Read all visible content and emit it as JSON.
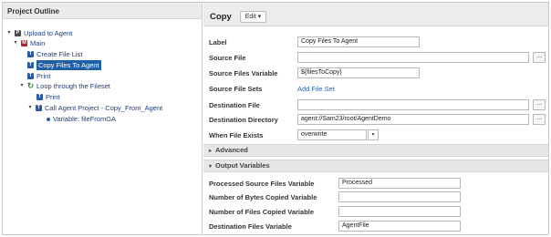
{
  "outline": {
    "title": "Project Outline",
    "nodes": [
      {
        "toggle": "▾",
        "icon": "P",
        "label": "Upload to Agent"
      },
      {
        "toggle": "▾",
        "icon": "M",
        "label": "Main"
      },
      {
        "toggle": "",
        "icon": "T",
        "label": "Create File List"
      },
      {
        "toggle": "",
        "icon": "T",
        "label": "Copy Files To Agent"
      },
      {
        "toggle": "",
        "icon": "T",
        "label": "Print"
      },
      {
        "toggle": "▾",
        "icon": "↻",
        "label": "Loop through the Fileset"
      },
      {
        "toggle": "",
        "icon": "T",
        "label": "Print"
      },
      {
        "toggle": "▾",
        "icon": "T",
        "label": "Call Agent Project - Copy_From_Agent"
      },
      {
        "toggle": "",
        "icon": "",
        "label": "Variable: fileFromGA"
      }
    ]
  },
  "detail": {
    "title": "Copy",
    "edit_label": "Edit ▾",
    "dots": "...",
    "fields": {
      "label": {
        "label": "Label",
        "value": "Copy Files To Agent"
      },
      "source_file": {
        "label": "Source File",
        "value": ""
      },
      "source_files_variable": {
        "label": "Source Files Variable",
        "value": "${filesToCopy}"
      },
      "source_file_sets": {
        "label": "Source File Sets",
        "link": "Add File Set"
      },
      "destination_file": {
        "label": "Destination File",
        "value": ""
      },
      "destination_directory": {
        "label": "Destination Directory",
        "value": "agent://Sam23/root/AgentDemo"
      },
      "when_file_exists": {
        "label": "When File Exists",
        "value": "overwrite",
        "arrow": "▾"
      }
    },
    "sections": {
      "advanced": {
        "arrow": "▸",
        "label": "Advanced"
      },
      "output_variables": {
        "arrow": "▾",
        "label": "Output Variables"
      }
    },
    "output": {
      "processed_source_files": {
        "label": "Processed Source Files Variable",
        "value": "Processed"
      },
      "bytes_copied": {
        "label": "Number of Bytes Copied Variable",
        "value": ""
      },
      "files_copied": {
        "label": "Number of Files Copied Variable",
        "value": ""
      },
      "destination_files": {
        "label": "Destination Files Variable",
        "value": "AgentFile"
      }
    }
  }
}
